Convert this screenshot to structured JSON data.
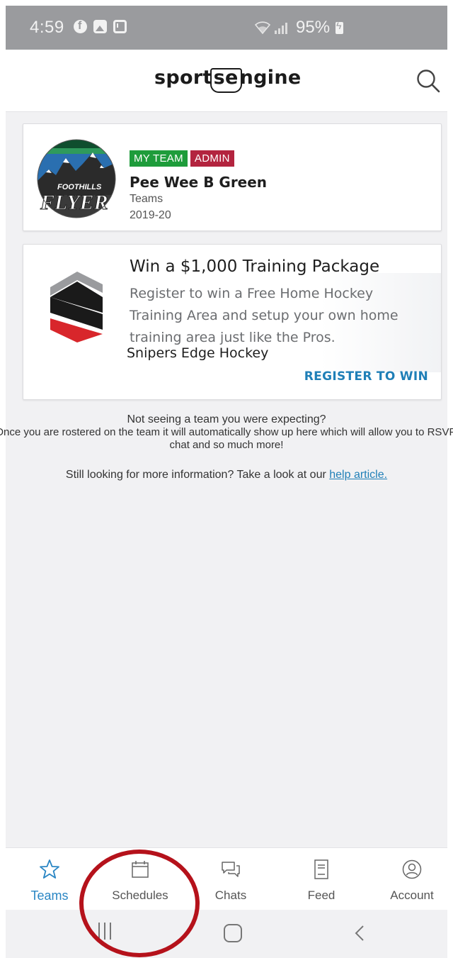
{
  "status_bar": {
    "time": "4:59",
    "battery": "95%",
    "notification_icons": [
      "facebook-icon",
      "gallery-icon",
      "mail-icon"
    ]
  },
  "header": {
    "logo_text_before": "sport",
    "logo_text_highlight": "se",
    "logo_text_after": "ngine",
    "search_icon": "search-icon"
  },
  "team_card": {
    "badge_my_team": "MY TEAM",
    "badge_admin": "ADMIN",
    "name": "Pee Wee B Green",
    "type": "Teams",
    "season": "2019-20",
    "logo_text": "FOOTHILLS FLYERS"
  },
  "promo_card": {
    "title": "Win a $1,000 Training Package",
    "body": "Register to win a Free Home Hockey Training Area and setup your own home training area just like the Pros.",
    "sponsor": "Snipers Edge Hockey",
    "cta": "REGISTER TO WIN"
  },
  "info": {
    "question": "Not seeing a team you were expecting?",
    "explanation": "Once you are rostered on the team it will automatically show up here which will allow you to RSVP, chat and so much more!",
    "more_prefix": "Still looking for more information? Take a look at our ",
    "help_link": "help article."
  },
  "bottom_nav": {
    "items": [
      {
        "label": "Teams",
        "icon": "star-icon",
        "active": true
      },
      {
        "label": "Schedules",
        "icon": "calendar-icon",
        "active": false
      },
      {
        "label": "Chats",
        "icon": "chat-icon",
        "active": false
      },
      {
        "label": "Feed",
        "icon": "feed-icon",
        "active": false
      },
      {
        "label": "Account",
        "icon": "account-icon",
        "active": false
      }
    ]
  },
  "colors": {
    "accent": "#2a86c4",
    "my_team_badge": "#1e9c3b",
    "admin_badge": "#b3243f",
    "cta": "#1f7fb7",
    "annotation": "#b5121b",
    "status_bar": "#9a9b9e",
    "content_bg": "#f1f1f3"
  }
}
